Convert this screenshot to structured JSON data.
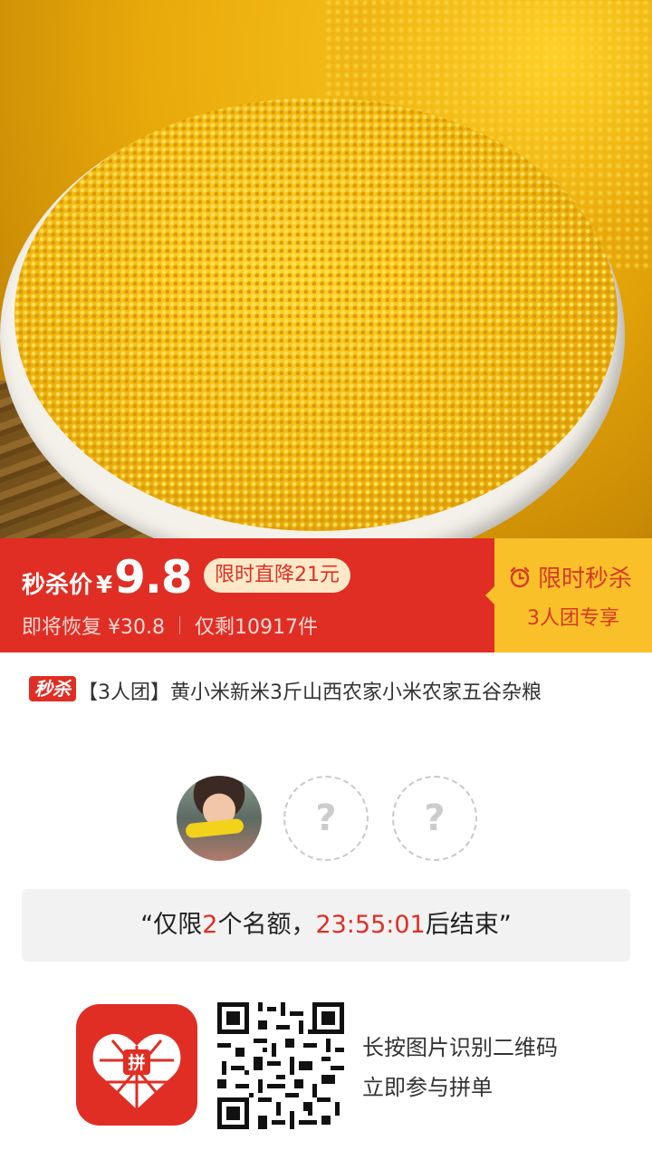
{
  "price_banner": {
    "label": "秒杀价",
    "currency": "¥",
    "price": "9.8",
    "drop_text": "限时直降21元",
    "restore_text": "即将恢复 ¥30.8",
    "remaining_text": "仅剩10917件",
    "flash_title": "限时秒杀",
    "group_exclusive": "3人团专享"
  },
  "product": {
    "tag": "秒杀",
    "title": "【3人团】黄小米新米3斤山西农家小米农家五谷杂粮"
  },
  "group": {
    "slot_symbol_1": "?",
    "slot_symbol_2": "?"
  },
  "quota": {
    "prefix": "“仅限",
    "count": "2",
    "mid": "个名额，",
    "timer": "23:55:01",
    "suffix": "后结束”"
  },
  "footer": {
    "line1": "长按图片识别二维码",
    "line2": "立即参与拼单",
    "logo_char": "拼"
  },
  "colors": {
    "brand_red": "#e02e24",
    "flash_yellow": "#f9c02a"
  }
}
